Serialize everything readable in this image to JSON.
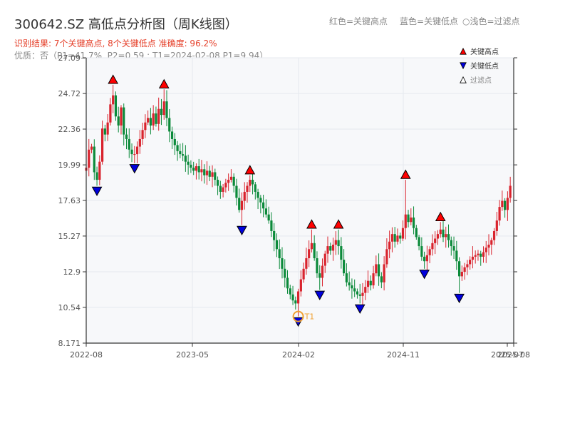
{
  "header": {
    "title": "300642.SZ 高低点分析图（周K线图）",
    "result_line": "识别结果: 7个关键高点, 8个关键低点  准确度: 96.2%",
    "quality_line": "优质：否（P1=41.7%, P2=0.59 ; T1=2024-02-08 P1=9.94）",
    "hint_red": "红色=关键高点",
    "hint_blue": "蓝色=关键低点",
    "hint_hollow": "○浅色=过滤点"
  },
  "colors": {
    "up": "#d9232d",
    "down": "#0b8a3a",
    "high_marker": "#ff0000",
    "low_marker": "#0000dd",
    "annotation": "#f0a030",
    "grid": "#e6e9ef",
    "plot_bg": "#f7f8fa"
  },
  "chart_data": {
    "type": "candlestick",
    "title": "300642.SZ 高低点分析图（周K线图）",
    "x_tick_labels": [
      "2022-08",
      "2023-05",
      "2024-02",
      "2024-11",
      "2025-07",
      "2025-08"
    ],
    "y_ticks": [
      8.171,
      10.54,
      12.9,
      15.27,
      17.63,
      19.99,
      22.36,
      24.72,
      27.09
    ],
    "ylim": [
      8.171,
      27.09
    ],
    "xlim": [
      "2022-08-01",
      "2025-08-20"
    ],
    "grid": true,
    "legend": [
      {
        "label": "关键高点",
        "marker": "triangle-up",
        "color": "#ff0000"
      },
      {
        "label": "关键低点",
        "marker": "triangle-down",
        "color": "#0000dd"
      },
      {
        "label": "过滤点",
        "marker": "triangle-up-hollow",
        "color": "#ffffff"
      }
    ],
    "legend_position": "top-right",
    "key_highs": [
      {
        "date": "2022-10-10",
        "value": 25.3
      },
      {
        "date": "2023-02-20",
        "value": 25.0
      },
      {
        "date": "2023-10-02",
        "value": 19.3
      },
      {
        "date": "2024-03-11",
        "value": 15.7
      },
      {
        "date": "2024-05-20",
        "value": 15.7
      },
      {
        "date": "2024-11-11",
        "value": 19.0
      },
      {
        "date": "2025-02-10",
        "value": 16.2
      }
    ],
    "key_lows": [
      {
        "date": "2022-08-29",
        "value": 18.6
      },
      {
        "date": "2022-12-05",
        "value": 20.1
      },
      {
        "date": "2023-09-11",
        "value": 16.0
      },
      {
        "date": "2024-02-05",
        "value": 9.94
      },
      {
        "date": "2024-04-01",
        "value": 11.7
      },
      {
        "date": "2024-07-15",
        "value": 10.8
      },
      {
        "date": "2024-12-30",
        "value": 13.1
      },
      {
        "date": "2025-03-31",
        "value": 11.5
      }
    ],
    "annotations": [
      {
        "label": "T1",
        "date": "2024-02-05",
        "value": 9.94
      }
    ],
    "price_path": [
      [
        "2022-08-01",
        19.8
      ],
      [
        "2022-08-08",
        21.0
      ],
      [
        "2022-08-15",
        21.2
      ],
      [
        "2022-08-22",
        19.5
      ],
      [
        "2022-08-29",
        19.0
      ],
      [
        "2022-09-05",
        20.2
      ],
      [
        "2022-09-12",
        22.4
      ],
      [
        "2022-09-19",
        22.0
      ],
      [
        "2022-09-26",
        22.8
      ],
      [
        "2022-10-03",
        24.0
      ],
      [
        "2022-10-10",
        24.6
      ],
      [
        "2022-10-17",
        23.2
      ],
      [
        "2022-10-24",
        22.6
      ],
      [
        "2022-10-31",
        23.8
      ],
      [
        "2022-11-07",
        22.0
      ],
      [
        "2022-11-14",
        21.7
      ],
      [
        "2022-11-21",
        21.0
      ],
      [
        "2022-11-28",
        20.7
      ],
      [
        "2022-12-05",
        20.7
      ],
      [
        "2022-12-12",
        21.2
      ],
      [
        "2022-12-19",
        21.7
      ],
      [
        "2022-12-26",
        22.3
      ],
      [
        "2023-01-02",
        22.8
      ],
      [
        "2023-01-09",
        23.1
      ],
      [
        "2023-01-16",
        22.6
      ],
      [
        "2023-01-23",
        23.4
      ],
      [
        "2023-01-30",
        22.7
      ],
      [
        "2023-02-06",
        23.7
      ],
      [
        "2023-02-13",
        23.3
      ],
      [
        "2023-02-20",
        24.2
      ],
      [
        "2023-02-27",
        23.1
      ],
      [
        "2023-03-06",
        22.2
      ],
      [
        "2023-03-13",
        21.7
      ],
      [
        "2023-03-20",
        21.3
      ],
      [
        "2023-03-27",
        20.9
      ],
      [
        "2023-04-03",
        20.7
      ],
      [
        "2023-04-10",
        20.6
      ],
      [
        "2023-04-17",
        20.2
      ],
      [
        "2023-04-24",
        20.0
      ],
      [
        "2023-05-01",
        19.8
      ],
      [
        "2023-05-08",
        19.6
      ],
      [
        "2023-05-15",
        19.9
      ],
      [
        "2023-05-22",
        19.5
      ],
      [
        "2023-05-29",
        19.7
      ],
      [
        "2023-06-05",
        19.3
      ],
      [
        "2023-06-12",
        19.6
      ],
      [
        "2023-06-19",
        19.2
      ],
      [
        "2023-06-26",
        19.5
      ],
      [
        "2023-07-03",
        19.0
      ],
      [
        "2023-07-10",
        18.6
      ],
      [
        "2023-07-17",
        18.2
      ],
      [
        "2023-07-24",
        18.5
      ],
      [
        "2023-07-31",
        18.8
      ],
      [
        "2023-08-07",
        19.0
      ],
      [
        "2023-08-14",
        19.2
      ],
      [
        "2023-08-21",
        18.6
      ],
      [
        "2023-08-28",
        17.8
      ],
      [
        "2023-09-04",
        17.0
      ],
      [
        "2023-09-11",
        17.6
      ],
      [
        "2023-09-18",
        18.2
      ],
      [
        "2023-09-25",
        18.6
      ],
      [
        "2023-10-02",
        19.0
      ],
      [
        "2023-10-09",
        18.7
      ],
      [
        "2023-10-16",
        18.2
      ],
      [
        "2023-10-23",
        17.8
      ],
      [
        "2023-10-30",
        17.5
      ],
      [
        "2023-11-06",
        17.1
      ],
      [
        "2023-11-13",
        16.7
      ],
      [
        "2023-11-20",
        16.3
      ],
      [
        "2023-11-27",
        15.6
      ],
      [
        "2023-12-04",
        15.0
      ],
      [
        "2023-12-11",
        14.4
      ],
      [
        "2023-12-18",
        13.8
      ],
      [
        "2023-12-25",
        13.1
      ],
      [
        "2024-01-01",
        12.5
      ],
      [
        "2024-01-08",
        11.8
      ],
      [
        "2024-01-15",
        11.4
      ],
      [
        "2024-01-22",
        11.0
      ],
      [
        "2024-01-29",
        10.8
      ],
      [
        "2024-02-05",
        11.6
      ],
      [
        "2024-02-12",
        12.4
      ],
      [
        "2024-02-19",
        13.1
      ],
      [
        "2024-02-26",
        13.8
      ],
      [
        "2024-03-04",
        14.4
      ],
      [
        "2024-03-11",
        14.8
      ],
      [
        "2024-03-18",
        13.8
      ],
      [
        "2024-03-25",
        12.8
      ],
      [
        "2024-04-01",
        12.5
      ],
      [
        "2024-04-08",
        13.3
      ],
      [
        "2024-04-15",
        14.1
      ],
      [
        "2024-04-22",
        14.6
      ],
      [
        "2024-04-29",
        14.3
      ],
      [
        "2024-05-06",
        14.7
      ],
      [
        "2024-05-13",
        15.0
      ],
      [
        "2024-05-20",
        14.6
      ],
      [
        "2024-05-27",
        13.7
      ],
      [
        "2024-06-03",
        12.8
      ],
      [
        "2024-06-10",
        12.2
      ],
      [
        "2024-06-17",
        12.0
      ],
      [
        "2024-06-24",
        11.8
      ],
      [
        "2024-07-01",
        11.6
      ],
      [
        "2024-07-08",
        11.4
      ],
      [
        "2024-07-15",
        11.3
      ],
      [
        "2024-07-22",
        11.5
      ],
      [
        "2024-07-29",
        11.9
      ],
      [
        "2024-08-05",
        12.3
      ],
      [
        "2024-08-12",
        12.0
      ],
      [
        "2024-08-19",
        12.8
      ],
      [
        "2024-08-26",
        13.4
      ],
      [
        "2024-09-02",
        12.6
      ],
      [
        "2024-09-09",
        12.2
      ],
      [
        "2024-09-16",
        13.4
      ],
      [
        "2024-09-23",
        14.4
      ],
      [
        "2024-09-30",
        14.9
      ],
      [
        "2024-10-07",
        15.4
      ],
      [
        "2024-10-14",
        14.9
      ],
      [
        "2024-10-21",
        15.3
      ],
      [
        "2024-10-28",
        15.1
      ],
      [
        "2024-11-04",
        15.8
      ],
      [
        "2024-11-11",
        16.7
      ],
      [
        "2024-11-18",
        16.2
      ],
      [
        "2024-11-25",
        16.5
      ],
      [
        "2024-12-02",
        15.8
      ],
      [
        "2024-12-09",
        15.2
      ],
      [
        "2024-12-16",
        14.6
      ],
      [
        "2024-12-23",
        13.9
      ],
      [
        "2024-12-30",
        13.6
      ],
      [
        "2025-01-06",
        14.0
      ],
      [
        "2025-01-13",
        14.4
      ],
      [
        "2025-01-20",
        14.8
      ],
      [
        "2025-01-27",
        15.1
      ],
      [
        "2025-02-03",
        15.4
      ],
      [
        "2025-02-10",
        15.7
      ],
      [
        "2025-02-17",
        15.2
      ],
      [
        "2025-02-24",
        15.4
      ],
      [
        "2025-03-03",
        15.0
      ],
      [
        "2025-03-10",
        14.6
      ],
      [
        "2025-03-17",
        14.3
      ],
      [
        "2025-03-24",
        13.6
      ],
      [
        "2025-03-31",
        12.6
      ],
      [
        "2025-04-07",
        12.9
      ],
      [
        "2025-04-14",
        13.2
      ],
      [
        "2025-04-21",
        13.4
      ],
      [
        "2025-04-28",
        13.7
      ],
      [
        "2025-05-05",
        13.9
      ],
      [
        "2025-05-12",
        14.0
      ],
      [
        "2025-05-19",
        14.1
      ],
      [
        "2025-05-26",
        13.9
      ],
      [
        "2025-06-02",
        14.2
      ],
      [
        "2025-06-09",
        14.5
      ],
      [
        "2025-06-16",
        14.7
      ],
      [
        "2025-06-23",
        15.0
      ],
      [
        "2025-06-30",
        15.6
      ],
      [
        "2025-07-07",
        16.3
      ],
      [
        "2025-07-14",
        17.2
      ],
      [
        "2025-07-21",
        17.6
      ],
      [
        "2025-07-28",
        17.0
      ],
      [
        "2025-08-04",
        17.8
      ],
      [
        "2025-08-11",
        18.6
      ]
    ]
  }
}
